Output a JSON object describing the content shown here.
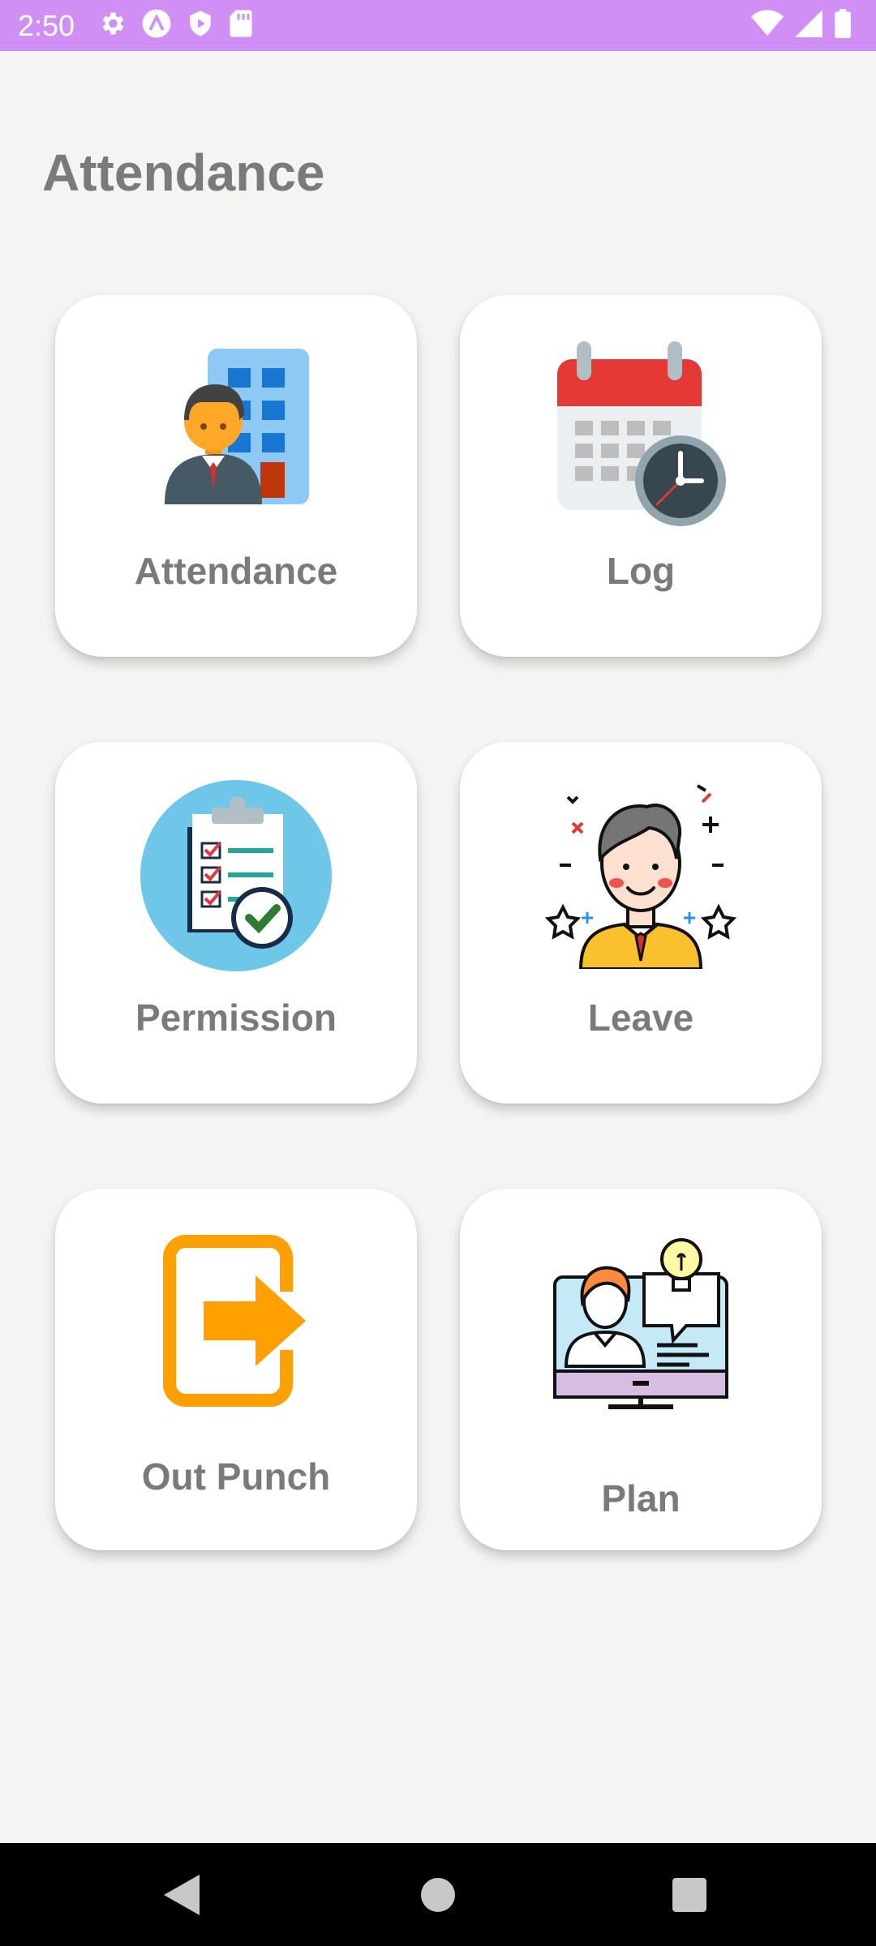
{
  "status_bar": {
    "time": "2:50",
    "left_icons": [
      "gear-icon",
      "app-a-icon",
      "play-protect-icon",
      "sd-card-icon"
    ],
    "right_icons": [
      "wifi-icon",
      "signal-icon",
      "battery-icon"
    ],
    "color": "#cf8ff4"
  },
  "page": {
    "title": "Attendance"
  },
  "cards": [
    {
      "label": "Attendance",
      "icon": "office-employee-icon"
    },
    {
      "label": "Log",
      "icon": "calendar-clock-icon"
    },
    {
      "label": "Permission",
      "icon": "clipboard-check-icon"
    },
    {
      "label": "Leave",
      "icon": "happy-employee-icon"
    },
    {
      "label": "Out Punch",
      "icon": "exit-arrow-icon"
    },
    {
      "label": "Plan",
      "icon": "computer-idea-icon"
    }
  ],
  "nav_bar": {
    "buttons": [
      "back-icon",
      "home-icon",
      "recents-icon"
    ]
  }
}
